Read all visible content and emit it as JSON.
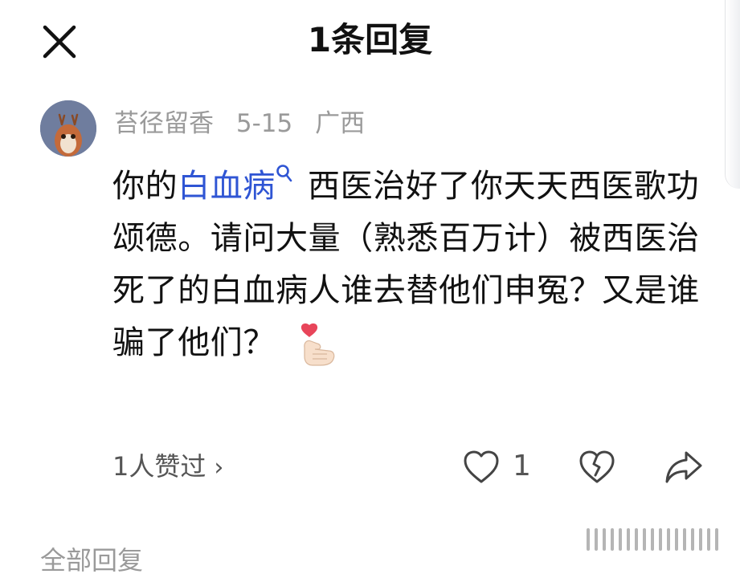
{
  "header": {
    "title": "1条回复"
  },
  "comment": {
    "username": "苔径留香",
    "date": "5-15",
    "location": "广西",
    "text_before": "你的",
    "keyword": "白血病",
    "text_after": "西医治好了你天天西医歌功颂德。请问大量（熟悉百万计）被西医治死了的白血病人谁去替他们申冤？又是谁骗了他们？"
  },
  "actions": {
    "liked_by": "1人赞过",
    "like_count": "1"
  },
  "section": {
    "title": "全部回复"
  },
  "icons": {
    "close": "close-icon",
    "avatar": "avatar",
    "search": "search-icon",
    "emoji": "finger-heart-emoji",
    "like": "heart-outline-icon",
    "dislike": "broken-heart-icon",
    "share": "share-arrow-icon",
    "chevron": "chevron-right-icon"
  },
  "colors": {
    "keyword": "#2f55d4",
    "secondary_text": "#9a9a9a",
    "primary_text": "#111111"
  }
}
